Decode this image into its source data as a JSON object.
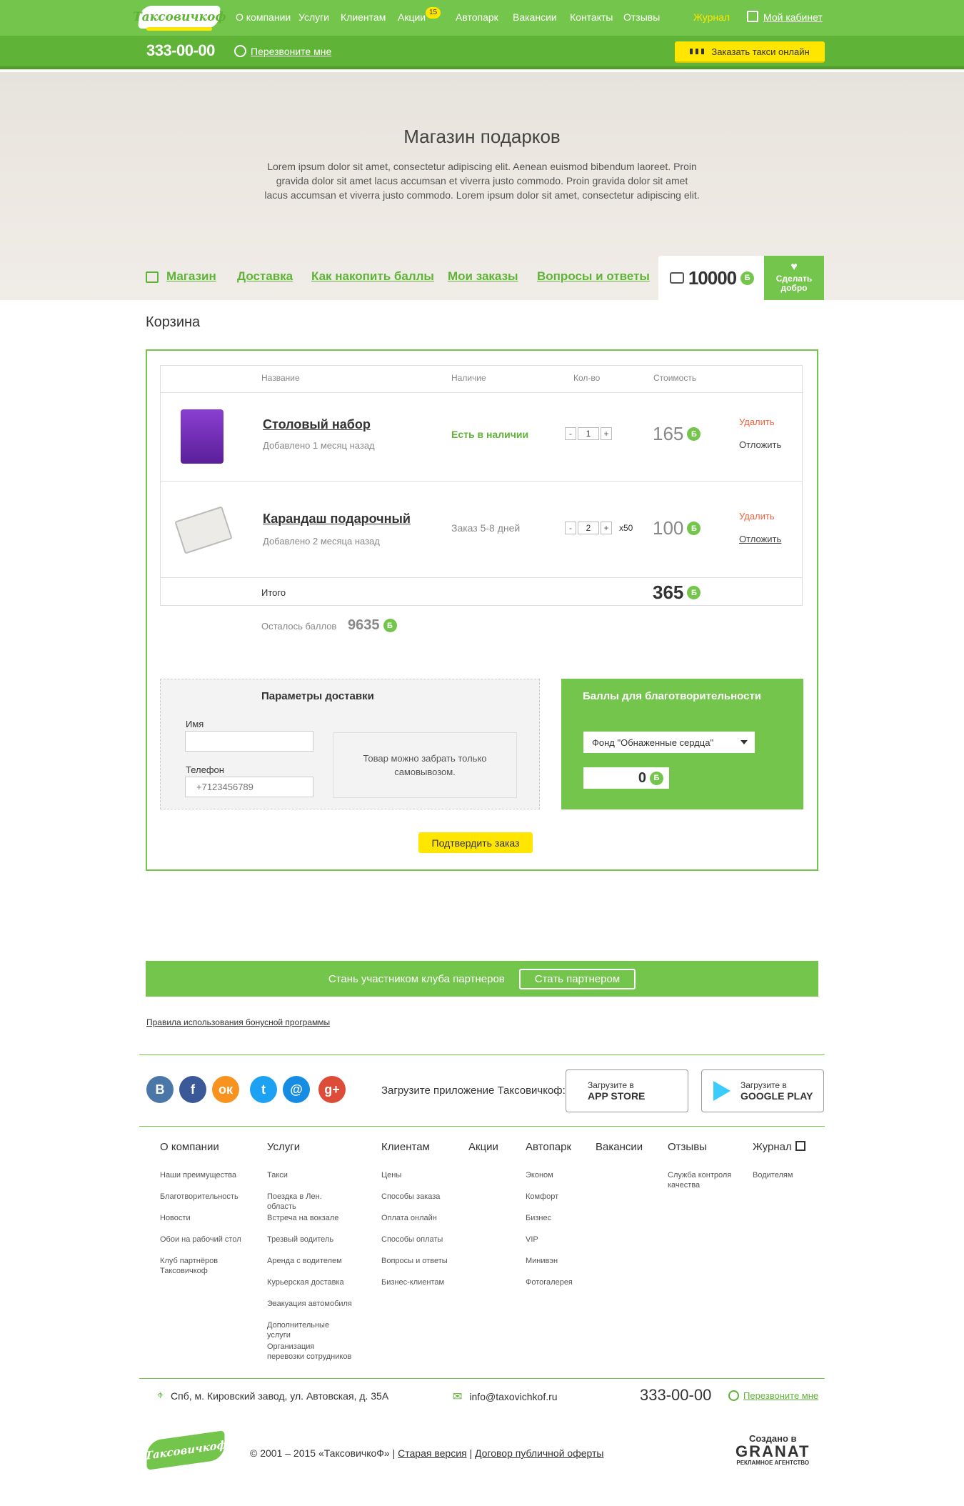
{
  "header": {
    "logo": "Таксовичкоф",
    "nav": [
      "О компании",
      "Услуги",
      "Клиентам",
      "Акции",
      "Автопарк",
      "Вакансии",
      "Контакты",
      "Отзывы"
    ],
    "promo_badge": "15",
    "journal": "Журнал",
    "cabinet": "Мой кабинет",
    "phone": "333-00-00",
    "callback": "Перезвоните мне",
    "order_button": "Заказать такси онлайн",
    "colors": {
      "green": "#74c54b",
      "dark_green": "#5fb336",
      "yellow": "#ffe600"
    }
  },
  "hero": {
    "title": "Магазин подарков",
    "text": "Lorem ipsum dolor sit amet, consectetur adipiscing elit. Aenean euismod bibendum laoreet. Proin gravida dolor sit amet lacus accumsan et viverra justo commodo. Proin gravida dolor sit amet lacus accumsan et viverra justo commodo. Lorem ipsum dolor sit amet, consectetur adipiscing elit.",
    "subnav": [
      "Магазин",
      "Доставка",
      "Как накопить баллы",
      "Мои заказы",
      "Вопросы и ответы"
    ],
    "balance": "10000",
    "currency": "Б",
    "good_deed": "Сделать добро"
  },
  "cart": {
    "title": "Корзина",
    "columns": [
      "Название",
      "Наличие",
      "Кол-во",
      "Стоимость"
    ],
    "items": [
      {
        "name": "Столовый набор",
        "added": "Добавлено 1 месяц назад",
        "stock": "Есть в наличии",
        "qty": "1",
        "multiplier": "",
        "price": "165",
        "delete": "Удалить",
        "later": "Отложить"
      },
      {
        "name": "Карандаш подарочный",
        "added": "Добавлено 2 месяца назад",
        "stock": "Заказ 5-8 дней",
        "qty": "2",
        "multiplier": "x50",
        "price": "100",
        "delete": "Удалить",
        "later": "Отложить"
      }
    ],
    "minus": "-",
    "plus": "+",
    "total_label": "Итого",
    "total": "365",
    "remaining_label": "Осталось баллов",
    "remaining": "9635"
  },
  "delivery": {
    "title": "Параметры доставки",
    "name_label": "Имя",
    "name_value": "",
    "phone_label": "Телефон",
    "phone_placeholder": "+7123456789",
    "pickup_note": "Товар можно забрать только самовывозом."
  },
  "charity": {
    "title": "Баллы для благотворительности",
    "fund": "Фонд \"Обнаженные сердца\"",
    "amount": "0"
  },
  "confirm": "Подтвердить заказ",
  "partner": {
    "text": "Стань участником клуба партнеров",
    "button": "Стать партнером"
  },
  "rules": "Правила использования бонусной программы",
  "social": {
    "icons": [
      {
        "name": "vk-icon",
        "glyph": "В",
        "color": "#4a76a8"
      },
      {
        "name": "facebook-icon",
        "glyph": "f",
        "color": "#3b5998"
      },
      {
        "name": "odnoklassniki-icon",
        "glyph": "ок",
        "color": "#f7931e"
      },
      {
        "name": "twitter-icon",
        "glyph": "t",
        "color": "#1da1f2"
      },
      {
        "name": "mail-icon",
        "glyph": "@",
        "color": "#168de2"
      },
      {
        "name": "google-plus-icon",
        "glyph": "g+",
        "color": "#dd4b39"
      }
    ],
    "app_label": "Загрузите приложение Таксовичкоф:",
    "appstore_top": "Загрузите в",
    "appstore": "APP STORE",
    "gplay_top": "Загрузите в",
    "gplay": "GOOGLE PLAY"
  },
  "footer": {
    "cols": [
      {
        "head": "О компании",
        "links": [
          "Наши преимущества",
          "Благотворительность",
          "Новости",
          "Обои на рабочий стол",
          "Клуб партнёров Таксовичкоф"
        ]
      },
      {
        "head": "Услуги",
        "links": [
          "Такси",
          "Поездка в Лен. область",
          "Встреча на вокзале",
          "Трезвый водитель",
          "Аренда с водителем",
          "Курьерская доставка",
          "Эвакуация автомобиля",
          "Дополнительные услуги",
          "Организация перевозки сотрудников"
        ]
      },
      {
        "head": "Клиентам",
        "links": [
          "Цены",
          "Способы заказа",
          "Оплата онлайн",
          "Способы оплаты",
          "Вопросы и ответы",
          "Бизнес-клиентам"
        ]
      },
      {
        "head": "Акции",
        "links": []
      },
      {
        "head": "Автопарк",
        "links": [
          "Эконом",
          "Комфорт",
          "Бизнес",
          "VIP",
          "Минивэн",
          "Фотогалерея"
        ]
      },
      {
        "head": "Вакансии",
        "links": []
      },
      {
        "head": "Отзывы",
        "links": [
          "Служба контроля качества"
        ]
      },
      {
        "head": "Журнал",
        "links": [
          "Водителям"
        ]
      }
    ],
    "address": "Спб, м. Кировский завод, ул. Автовская, д. 35А",
    "email": "info@taxovichkof.ru",
    "phone": "333-00-00",
    "callback": "Перезвоните мне",
    "copyright": "© 2001 – 2015 «ТаксовичкоФ» |",
    "old_version": "Старая версия",
    "sep": "|",
    "offer": "Договор публичной оферты",
    "logo": "Таксовичкоф",
    "made_by": "Создано в",
    "agency": "GRANAT",
    "agency_sub": "РЕКЛАМНОЕ АГЕНТСТВО"
  }
}
